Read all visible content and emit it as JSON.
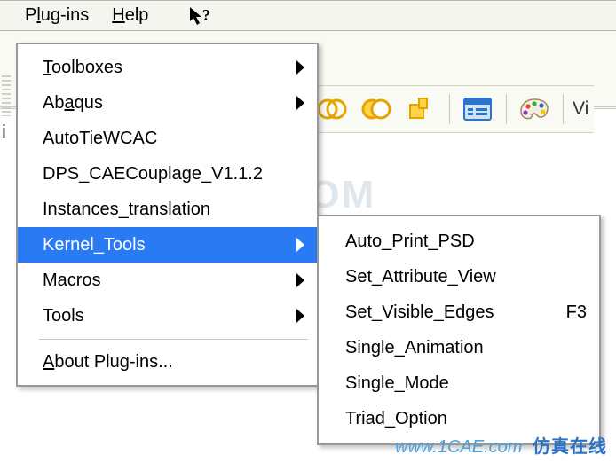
{
  "menubar": {
    "plugins_pre": "P",
    "plugins_u": "l",
    "plugins_post": "ug-ins",
    "help_u": "H",
    "help_post": "elp"
  },
  "menu": {
    "items": [
      {
        "u": "T",
        "post": "oolboxes",
        "sub": true
      },
      {
        "pre": "Ab",
        "u": "a",
        "post": "qus",
        "sub": true
      },
      {
        "label": "AutoTieWCAC"
      },
      {
        "label": "DPS_CAECouplage_V1.1.2"
      },
      {
        "label": "Instances_translation"
      },
      {
        "label": "Kernel_Tools",
        "sub": true,
        "hl": true
      },
      {
        "label": "Macros",
        "sub": true
      },
      {
        "label": "Tools",
        "sub": true
      }
    ],
    "about_u": "A",
    "about_post": "bout Plug-ins..."
  },
  "submenu": {
    "items": [
      {
        "label": "Auto_Print_PSD"
      },
      {
        "label": "Set_Attribute_View"
      },
      {
        "label": "Set_Visible_Edges",
        "accel": "F3"
      },
      {
        "label": "Single_Animation"
      },
      {
        "label": "Single_Mode"
      },
      {
        "label": "Triad_Option"
      }
    ]
  },
  "toolbar": {
    "vi": "Vi"
  },
  "frag": {
    "left": "i"
  },
  "wm": {
    "mid": "1CAE.COM",
    "url": "www.1CAE.com",
    "cn": "仿真在线"
  }
}
